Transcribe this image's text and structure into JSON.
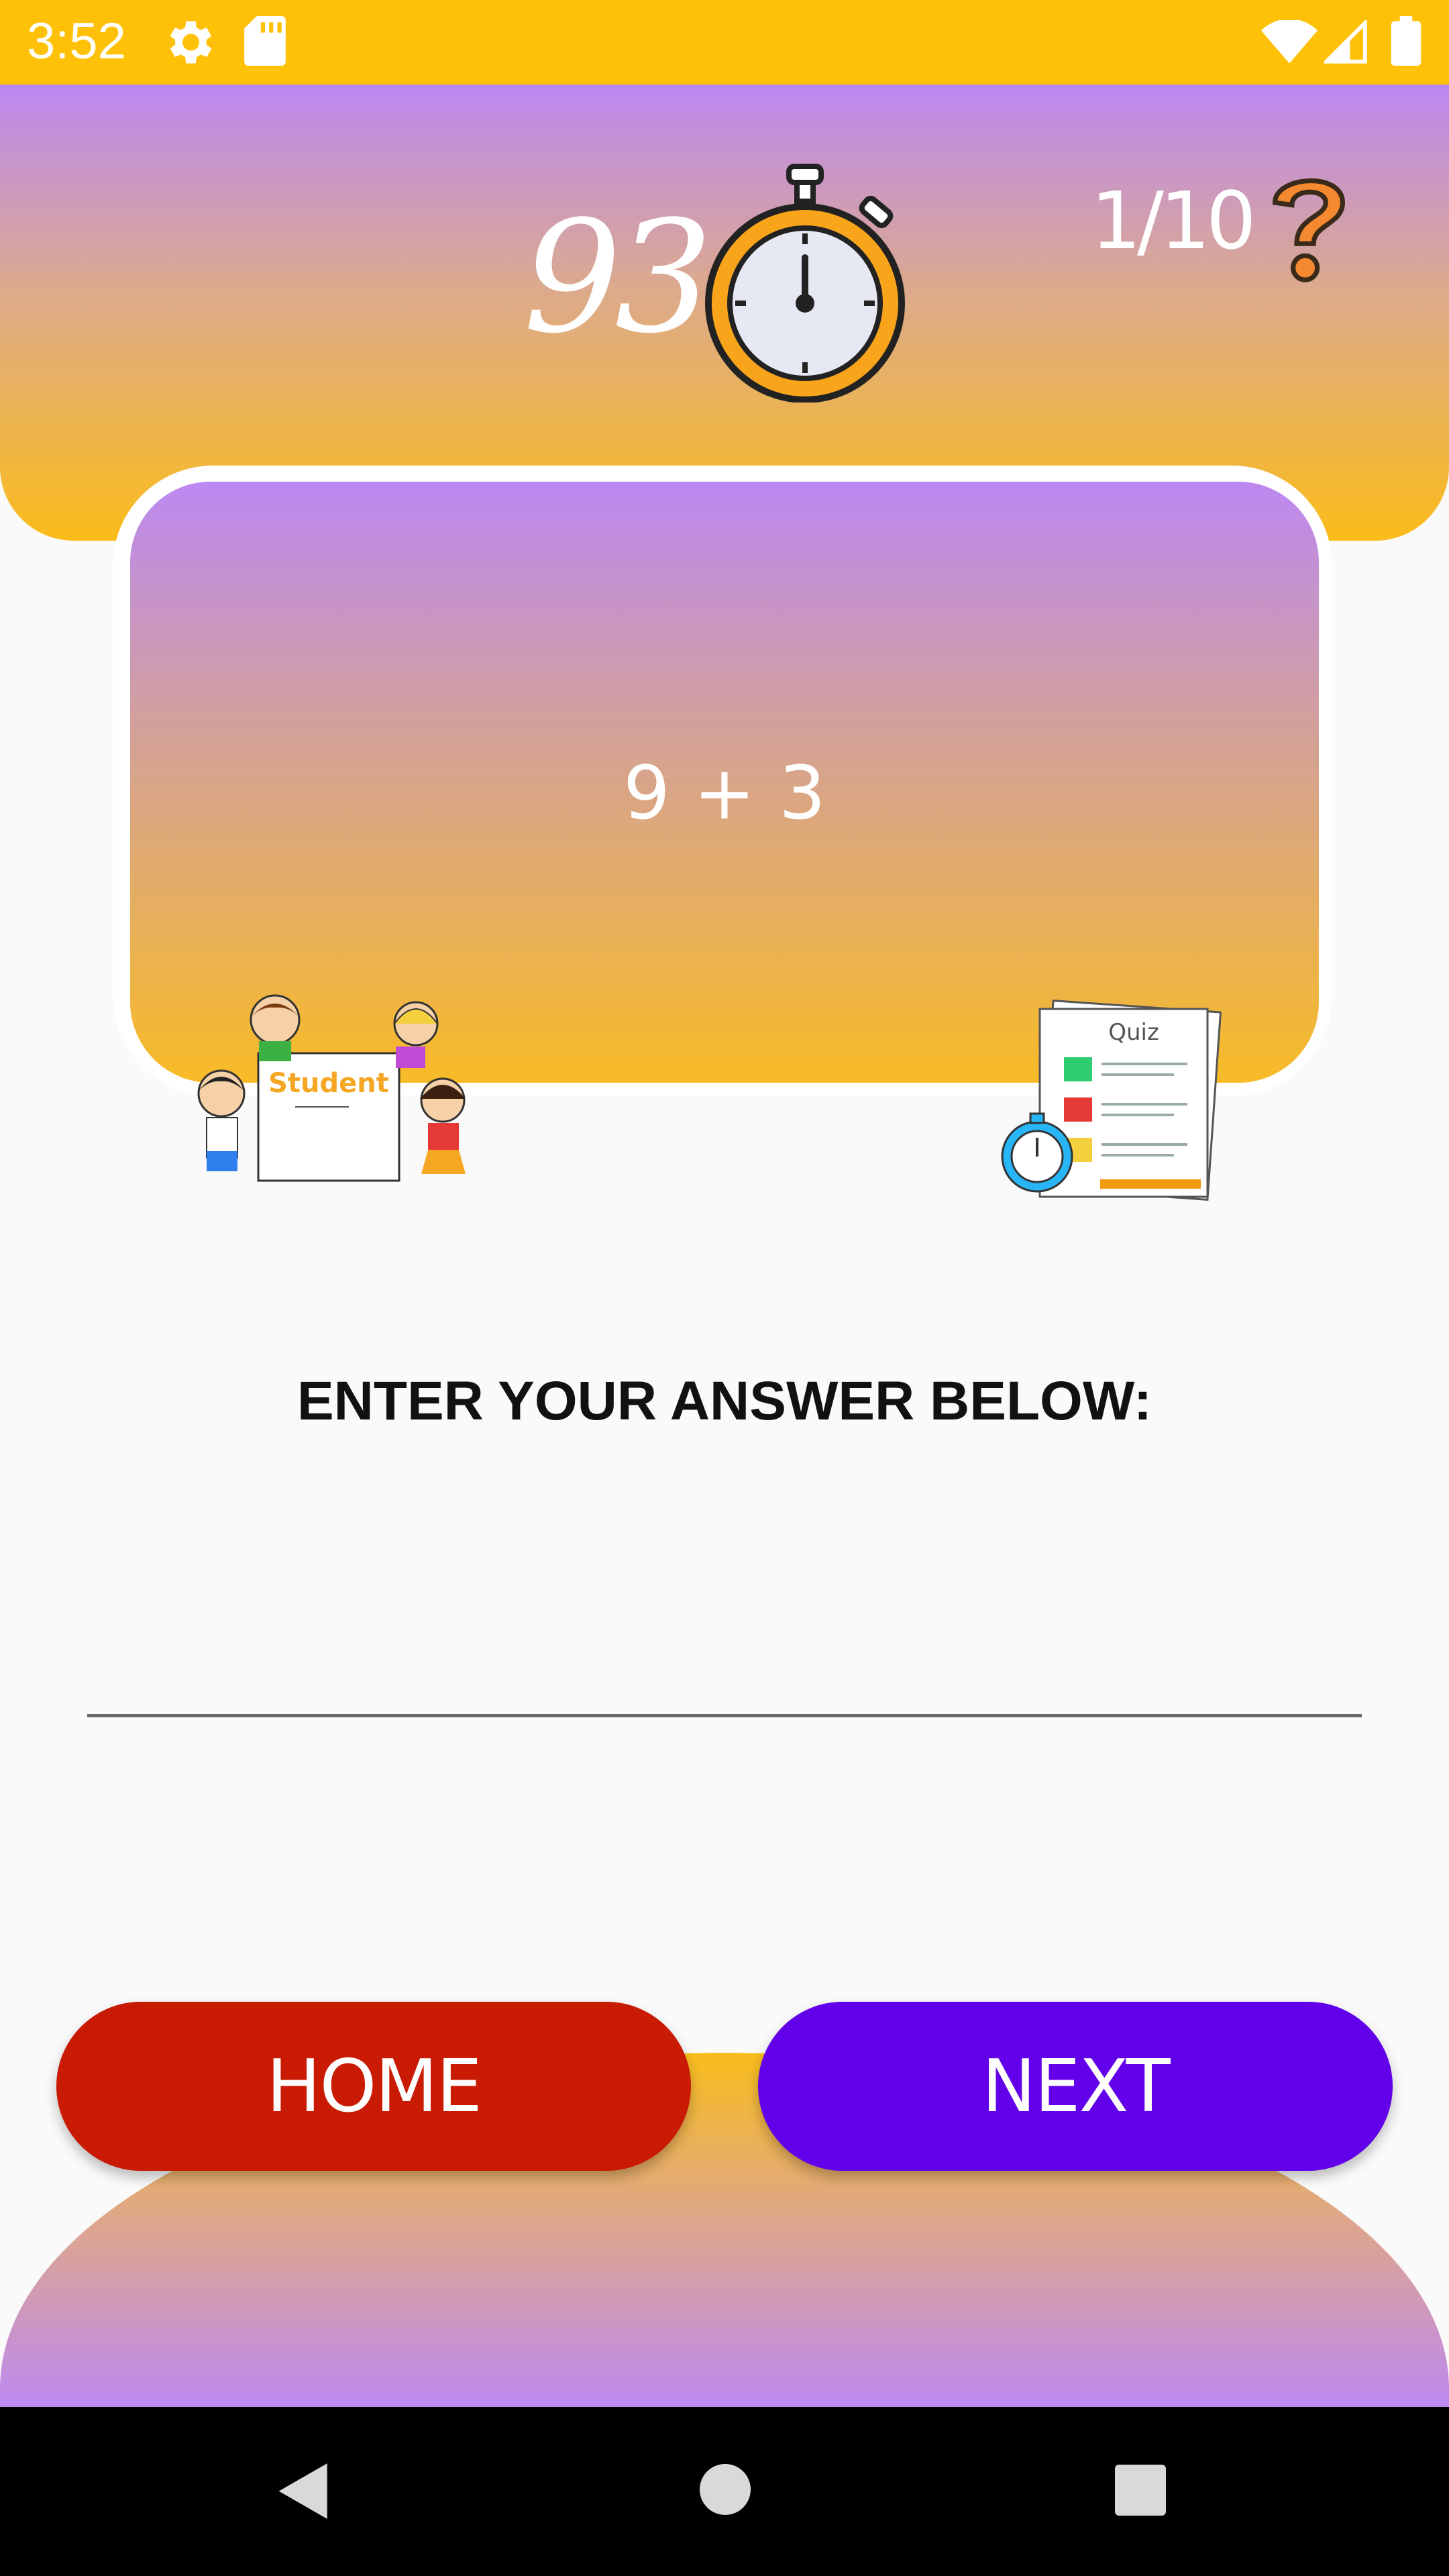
{
  "status_bar": {
    "time": "3:52",
    "icons": [
      "gear-icon",
      "sd-card-icon",
      "wifi-icon",
      "signal-icon",
      "battery-icon"
    ]
  },
  "header": {
    "timer_value": "93",
    "timer_icon": "stopwatch-icon",
    "progress": "1/10",
    "help_icon": "question-mark-icon"
  },
  "question": {
    "text": "9 + 3"
  },
  "illustrations": {
    "left_sign_text": "Student",
    "right_doc_text": "Quiz"
  },
  "answer": {
    "label": "ENTER YOUR ANSWER BELOW:",
    "value": "",
    "placeholder": ""
  },
  "buttons": {
    "home_label": "HOME",
    "next_label": "NEXT"
  },
  "colors": {
    "status_bar": "#ffc107",
    "gradient_purple": "#bc88f2",
    "gradient_yellow": "#fbbc1a",
    "home_button": "#c91a04",
    "next_button": "#6200ea"
  },
  "nav_bar": {
    "icons": [
      "back-icon",
      "home-circle-icon",
      "recent-apps-icon"
    ]
  }
}
